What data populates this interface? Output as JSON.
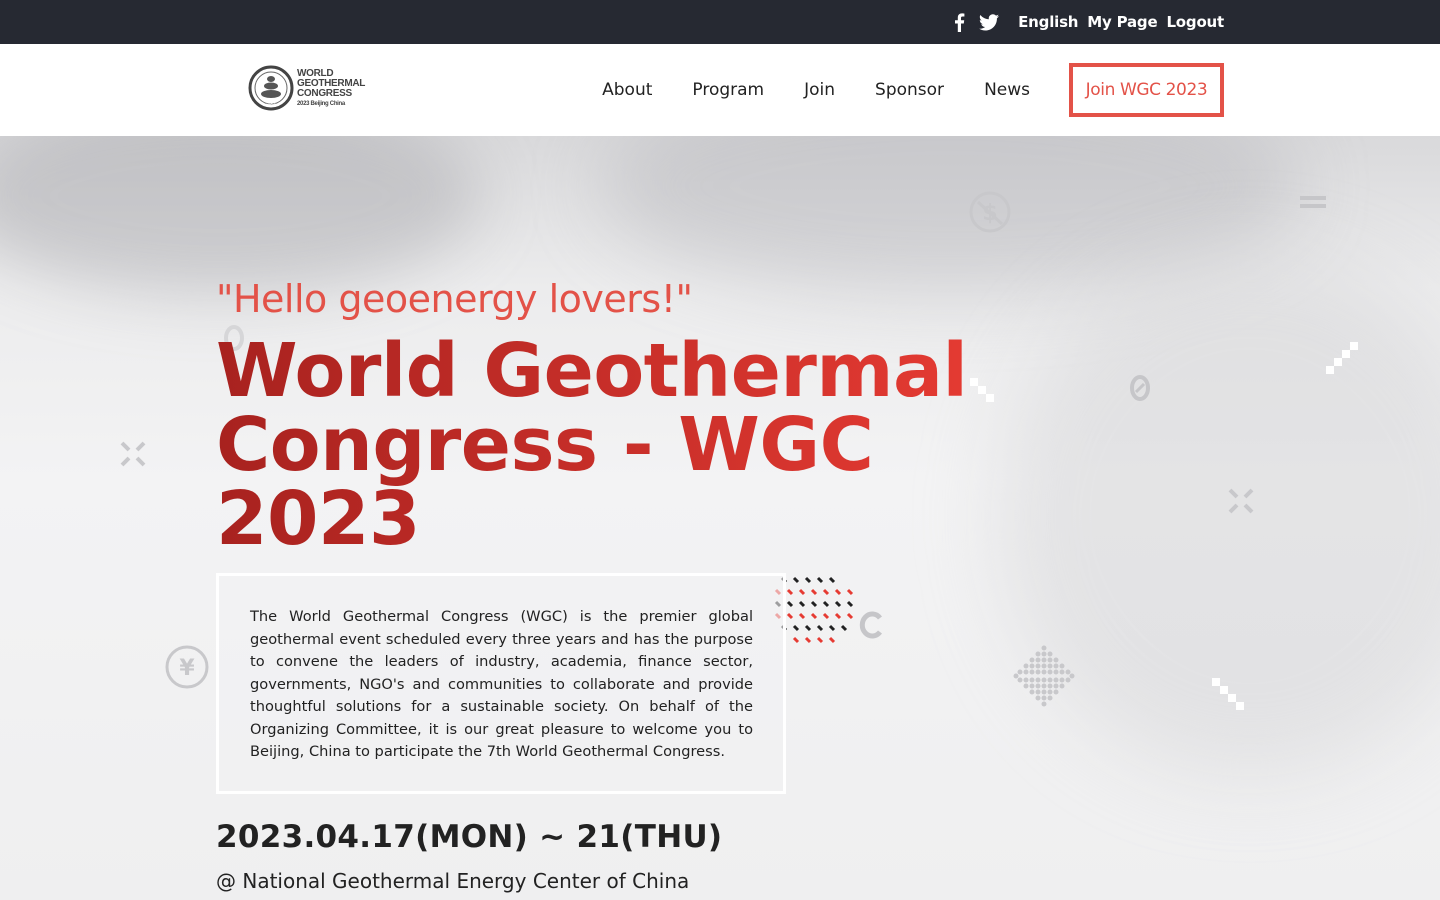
{
  "topbar": {
    "social_icons": [
      "facebook-icon",
      "twitter-icon"
    ],
    "language": "English",
    "my_page": "My Page",
    "logout": "Logout"
  },
  "logo": {
    "line1": "WORLD",
    "line2": "GEOTHERMAL",
    "line3": "CONGRESS",
    "line4": "2023 Beijing China"
  },
  "nav": {
    "items": [
      "About",
      "Program",
      "Join",
      "Sponsor",
      "News"
    ],
    "cta": "Join WGC 2023"
  },
  "hero": {
    "tagline": "\"Hello geoenergy lovers!\"",
    "title": "World Geothermal Congress - WGC 2023",
    "description": "The World Geothermal Congress (WGC) is the premier global geothermal event scheduled every three years and has the purpose to convene the leaders of industry, academia, finance sector, governments, NGO's and communities to collaborate and provide thoughtful solutions for a sustainable society. On behalf of the Organizing Committee, it is our great pleasure to welcome you to Beijing, China to participate the 7th World Geothermal Congress.",
    "date": "2023.04.17(MON) ~ 21(THU)",
    "venue": "@ National Geothermal Energy Center of China"
  },
  "colors": {
    "accent": "#e35248",
    "title_dark": "#a8221f",
    "title_light": "#e63b33",
    "topbar_bg": "#262932"
  }
}
